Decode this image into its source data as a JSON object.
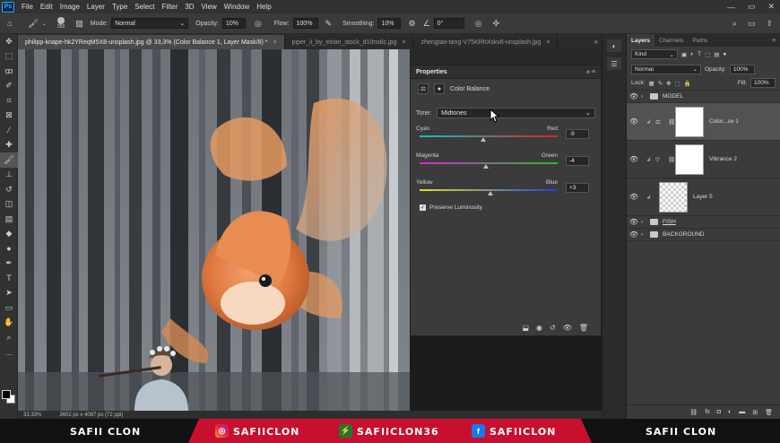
{
  "menu": {
    "logo": "Ps",
    "items": [
      "File",
      "Edit",
      "Image",
      "Layer",
      "Type",
      "Select",
      "Filter",
      "3D",
      "View",
      "Window",
      "Help"
    ]
  },
  "options": {
    "brush_size": "250",
    "mode_label": "Mode:",
    "mode_value": "Normal",
    "opacity_label": "Opacity:",
    "opacity_value": "10%",
    "flow_label": "Flow:",
    "flow_value": "100%",
    "smoothing_label": "Smoothing:",
    "smoothing_value": "10%",
    "angle_value": "0°"
  },
  "tabs": [
    {
      "label": "philipp-knape-hk2YReqM5X8-unsplash.jpg @ 33,3% (Color Balance 1, Layer Mask/8) *",
      "active": true
    },
    {
      "label": "piper_ii_by_eirian_stock_d10ns6c.jpg",
      "active": false
    },
    {
      "label": "zhengtao-tang-V75KRhXskv8-unsplash.jpg",
      "active": false
    }
  ],
  "status": {
    "zoom": "33,33%",
    "doc_size": "3602 px x 4087 px (72 ppi)"
  },
  "properties": {
    "title": "Properties",
    "subtitle": "Color Balance",
    "tone_label": "Tone:",
    "tone_value": "Midtones",
    "sliders": [
      {
        "left": "Cyan",
        "right": "Red",
        "value": "-9",
        "pos": 0.46,
        "gradient": [
          "#00c8c8",
          "#e02020"
        ]
      },
      {
        "left": "Magenta",
        "right": "Green",
        "value": "-4",
        "pos": 0.48,
        "gradient": [
          "#e020e0",
          "#20c020"
        ]
      },
      {
        "left": "Yellow",
        "right": "Blue",
        "value": "+3",
        "pos": 0.51,
        "gradient": [
          "#e0e020",
          "#2040e0"
        ]
      }
    ],
    "preserve_label": "Preserve Luminosity",
    "preserve_checked": true
  },
  "layers_panel": {
    "tabs": [
      "Layers",
      "Channels",
      "Paths"
    ],
    "kind_label": "Kind",
    "blend_mode": "Normal",
    "opacity_label": "Opacity:",
    "opacity_value": "100%",
    "lock_label": "Lock:",
    "fill_label": "Fill:",
    "fill_value": "100%",
    "layers": [
      {
        "name": "MODEL",
        "type": "group"
      },
      {
        "name": "Color...ce 1",
        "type": "adjustment",
        "selected": true
      },
      {
        "name": "Vibrance 2",
        "type": "adjustment",
        "selected": false
      },
      {
        "name": "Layer 5",
        "type": "pixel",
        "selected": false
      },
      {
        "name": "FISH",
        "type": "group"
      },
      {
        "name": "BACKGROUND",
        "type": "group"
      }
    ]
  },
  "banner": {
    "left_name": "SAFII CLON",
    "instagram": "SAFIICLON",
    "other": "SAFIICLON36",
    "facebook": "SAFIICLON",
    "right_name": "SAFII CLON",
    "red": "#c8102e"
  }
}
